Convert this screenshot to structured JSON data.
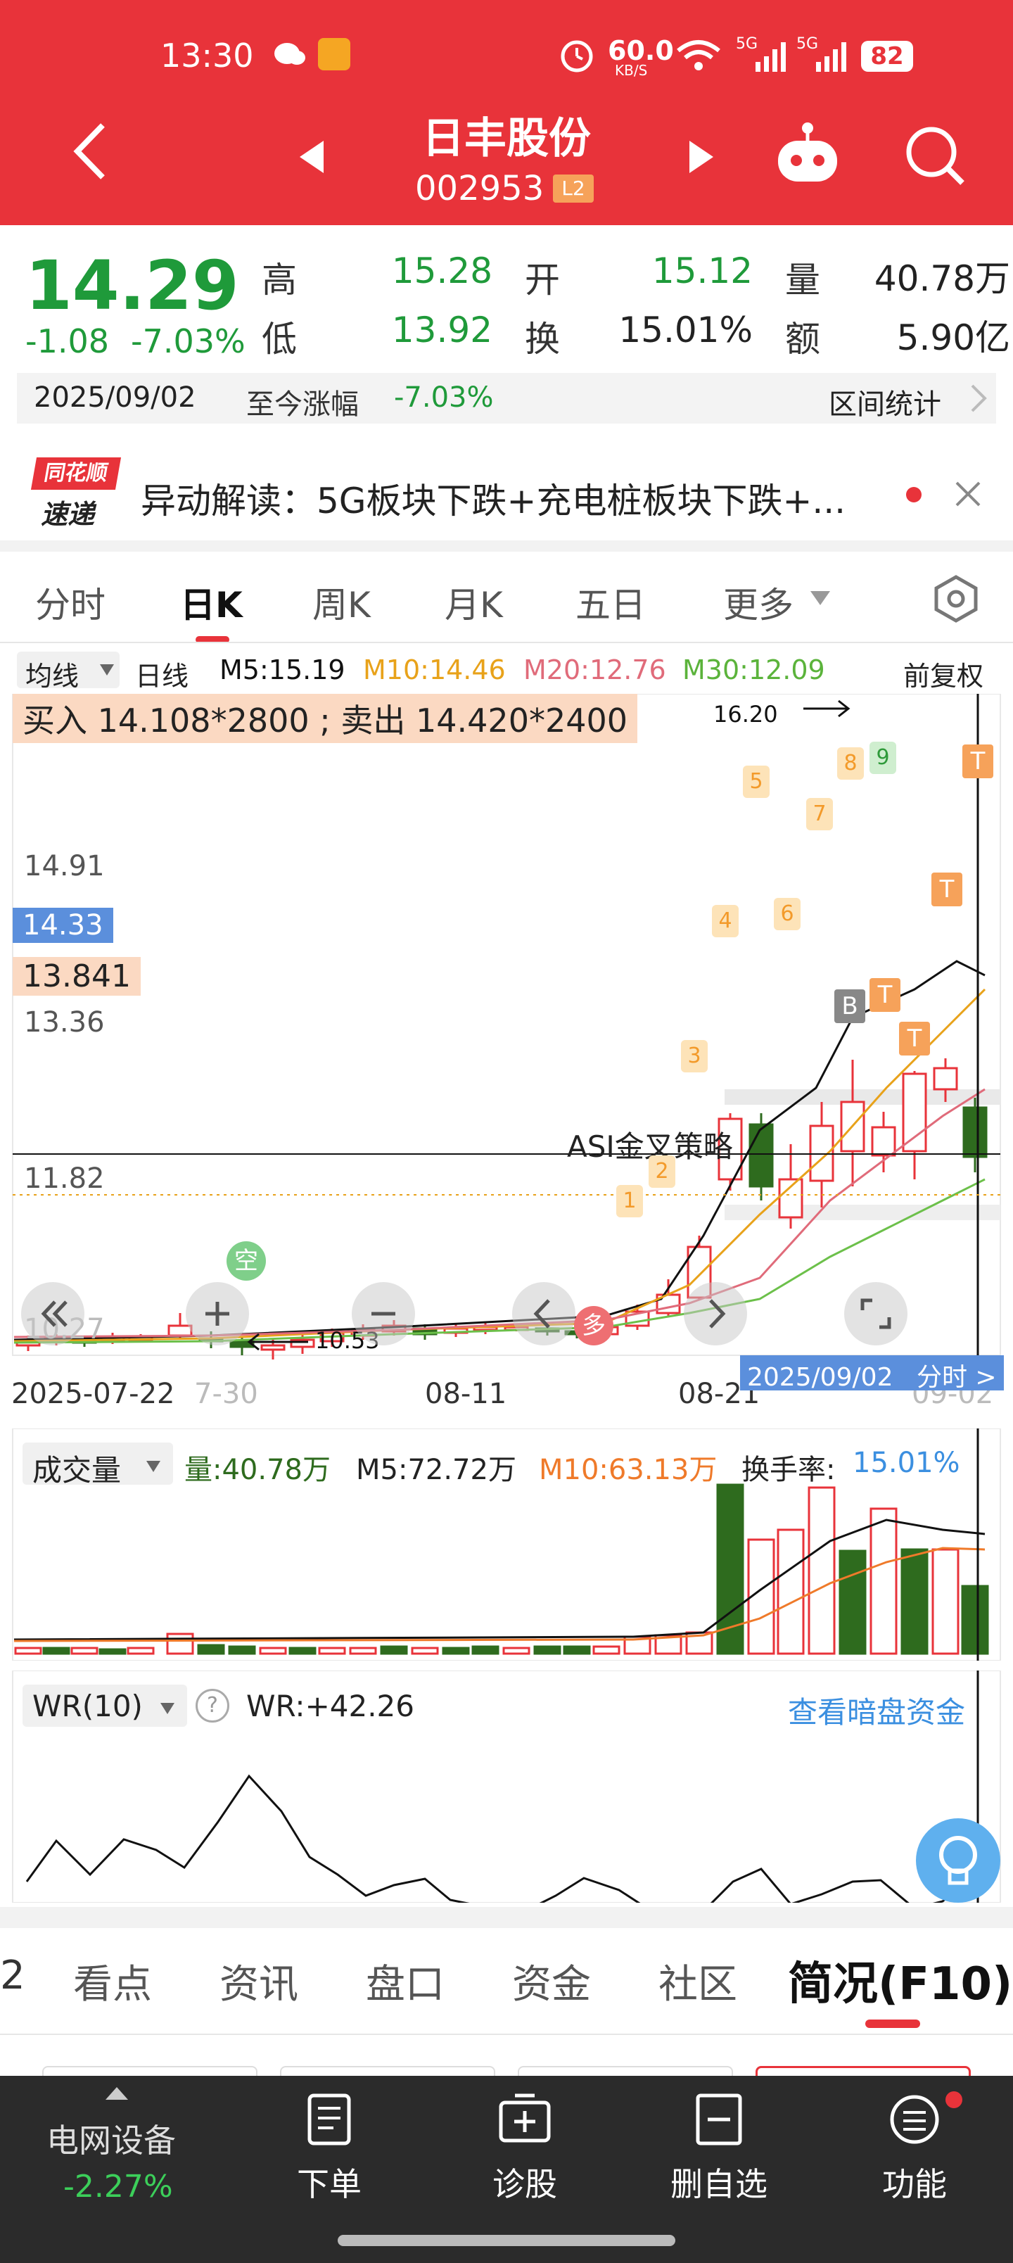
{
  "status": {
    "time": "13:30",
    "net_speed": "60.0",
    "net_unit": "KB/S",
    "battery": "82",
    "signal1": "5G",
    "signal2": "5G"
  },
  "header": {
    "title": "日丰股份",
    "code": "002953",
    "level_badge": "L2"
  },
  "quote": {
    "price": "14.29",
    "change": "-1.08",
    "change_pct": "-7.03%",
    "high_label": "高",
    "high": "15.28",
    "low_label": "低",
    "low": "13.92",
    "open_label": "开",
    "open": "15.12",
    "turnover_label": "换",
    "turnover": "15.01%",
    "volume_label": "量",
    "volume": "40.78万",
    "amount_label": "额",
    "amount": "5.90亿"
  },
  "date_bar": {
    "date": "2025/09/02",
    "since_label": "至今涨幅",
    "since_value": "-7.03%",
    "range_stats": "区间统计"
  },
  "news": {
    "logo_top": "同花顺",
    "logo_bottom": "速递",
    "text": "异动解读：5G板块下跌+充电桩板块下跌+..."
  },
  "tabs": [
    "分时",
    "日K",
    "周K",
    "月K",
    "五日",
    "更多"
  ],
  "active_tab": "日K",
  "ma_legend": {
    "indicator": "均线",
    "period": "日线",
    "m5": "M5:15.19",
    "m10": "M10:14.46",
    "m20": "M20:12.76",
    "m30": "M30:12.09",
    "adjust": "前复权"
  },
  "kchart": {
    "trade_note": "买入 14.108*2800 ; 卖出 14.420*2400",
    "high_mark": "16.20",
    "low_mark": "10.53",
    "y_labels": [
      "14.91",
      "13.36",
      "11.82",
      "10.27"
    ],
    "crosshair_price": "14.33",
    "cost_price": "13.841",
    "strategy_label": "ASI金叉策略",
    "date_labels": [
      "2025-07-22",
      "7-30",
      "08-11",
      "08-21",
      "09-02"
    ],
    "selected_date": "2025/09/02",
    "minute_link": "分时 >",
    "signals": {
      "kong": "空",
      "duo": "多",
      "buy": "B",
      "t": "T",
      "seq": [
        "1",
        "2",
        "3",
        "4",
        "5",
        "6",
        "7",
        "8",
        "9"
      ]
    },
    "colors": {
      "up": "#e8333a",
      "down": "#2e6b1e",
      "m5": "#111111",
      "m10": "#e8a21a",
      "m20": "#e06b7a",
      "m30": "#6cc04a"
    }
  },
  "volume_panel": {
    "name": "成交量",
    "vol": "量:40.78万",
    "m5": "M5:72.72万",
    "m10": "M10:63.13万",
    "turnover_label": "换手率:",
    "turnover_value": "15.01%"
  },
  "wr_panel": {
    "name": "WR(10)",
    "help": "?",
    "value": "WR:+42.26",
    "link": "查看暗盘资金"
  },
  "bottom_tabs": [
    "2",
    "看点",
    "资讯",
    "盘口",
    "资金",
    "社区",
    "简况(F10)"
  ],
  "bottom_bar": {
    "sector_name": "电网设备",
    "sector_change": "-2.27%",
    "order": "下单",
    "diagnose": "诊股",
    "remove_watch": "删自选",
    "functions": "功能"
  }
}
